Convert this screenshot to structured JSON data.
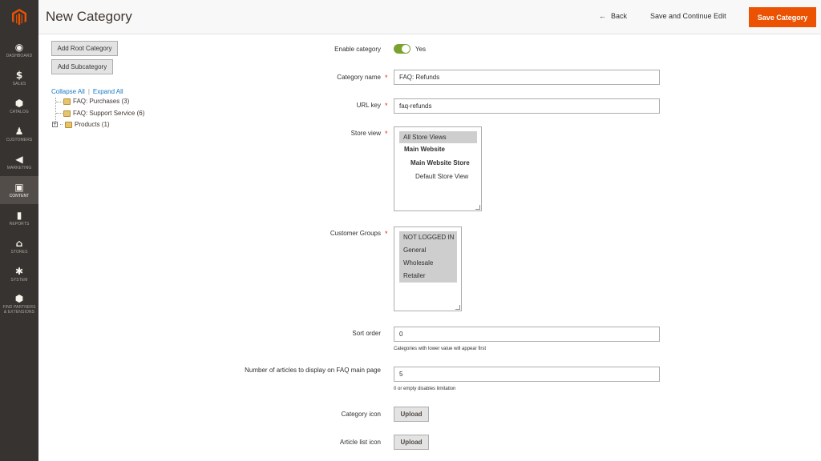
{
  "colors": {
    "sidebar_bg": "#373330",
    "accent": "#eb5202",
    "toggle_on": "#79a22e",
    "link": "#1979c3",
    "required": "#e22626"
  },
  "sidebar": {
    "logo_icon": "magento-logo-icon",
    "items": [
      {
        "label": "DASHBOARD",
        "icon": "dashboard-icon",
        "glyph": "◉"
      },
      {
        "label": "SALES",
        "icon": "dollar-icon",
        "glyph": "$"
      },
      {
        "label": "CATALOG",
        "icon": "cube-icon",
        "glyph": "⬢"
      },
      {
        "label": "CUSTOMERS",
        "icon": "person-icon",
        "glyph": "♟"
      },
      {
        "label": "MARKETING",
        "icon": "megaphone-icon",
        "glyph": "◀"
      },
      {
        "label": "CONTENT",
        "icon": "layout-icon",
        "glyph": "▣"
      },
      {
        "label": "REPORTS",
        "icon": "bar-chart-icon",
        "glyph": "▮"
      },
      {
        "label": "STORES",
        "icon": "storefront-icon",
        "glyph": "⌂"
      },
      {
        "label": "SYSTEM",
        "icon": "gear-icon",
        "glyph": "✱"
      },
      {
        "label": "FIND PARTNERS\n& EXTENSIONS",
        "icon": "box-icon",
        "glyph": "⬢"
      }
    ]
  },
  "header": {
    "title": "New Category",
    "back_label": "Back",
    "back_icon": "arrow-left-icon",
    "back_arrow": "←",
    "save_continue_label": "Save and Continue Edit",
    "save_label": "Save Category"
  },
  "tree": {
    "add_root_label": "Add Root Category",
    "add_sub_label": "Add Subcategory",
    "collapse_all": "Collapse All",
    "separator": "|",
    "expand_all": "Expand All",
    "expander_glyph": "+",
    "nodes": [
      {
        "label": "FAQ: Purchases (3)"
      },
      {
        "label": "FAQ: Support Service (6)"
      },
      {
        "label": "Products (1)"
      }
    ]
  },
  "form": {
    "enable": {
      "label": "Enable category",
      "value": "Yes"
    },
    "name": {
      "label": "Category name",
      "value": "FAQ: Refunds"
    },
    "url_key": {
      "label": "URL key",
      "value": "faq-refunds"
    },
    "required_mark": "*",
    "store_view": {
      "label": "Store view",
      "options": [
        "All Store Views",
        "Main Website",
        "Main Website Store",
        "Default Store View"
      ]
    },
    "customer_groups": {
      "label": "Customer Groups",
      "options": [
        "NOT LOGGED IN",
        "General",
        "Wholesale",
        "Retailer"
      ]
    },
    "sort_order": {
      "label": "Sort order",
      "value": "0",
      "note": "Categories with lower value will appear first"
    },
    "articles_count": {
      "label": "Number of articles to display on FAQ main page",
      "value": "5",
      "note": "0 or empty disables limitation"
    },
    "category_icon": {
      "label": "Category icon",
      "button": "Upload"
    },
    "article_list_icon": {
      "label": "Article list icon",
      "button": "Upload"
    }
  }
}
